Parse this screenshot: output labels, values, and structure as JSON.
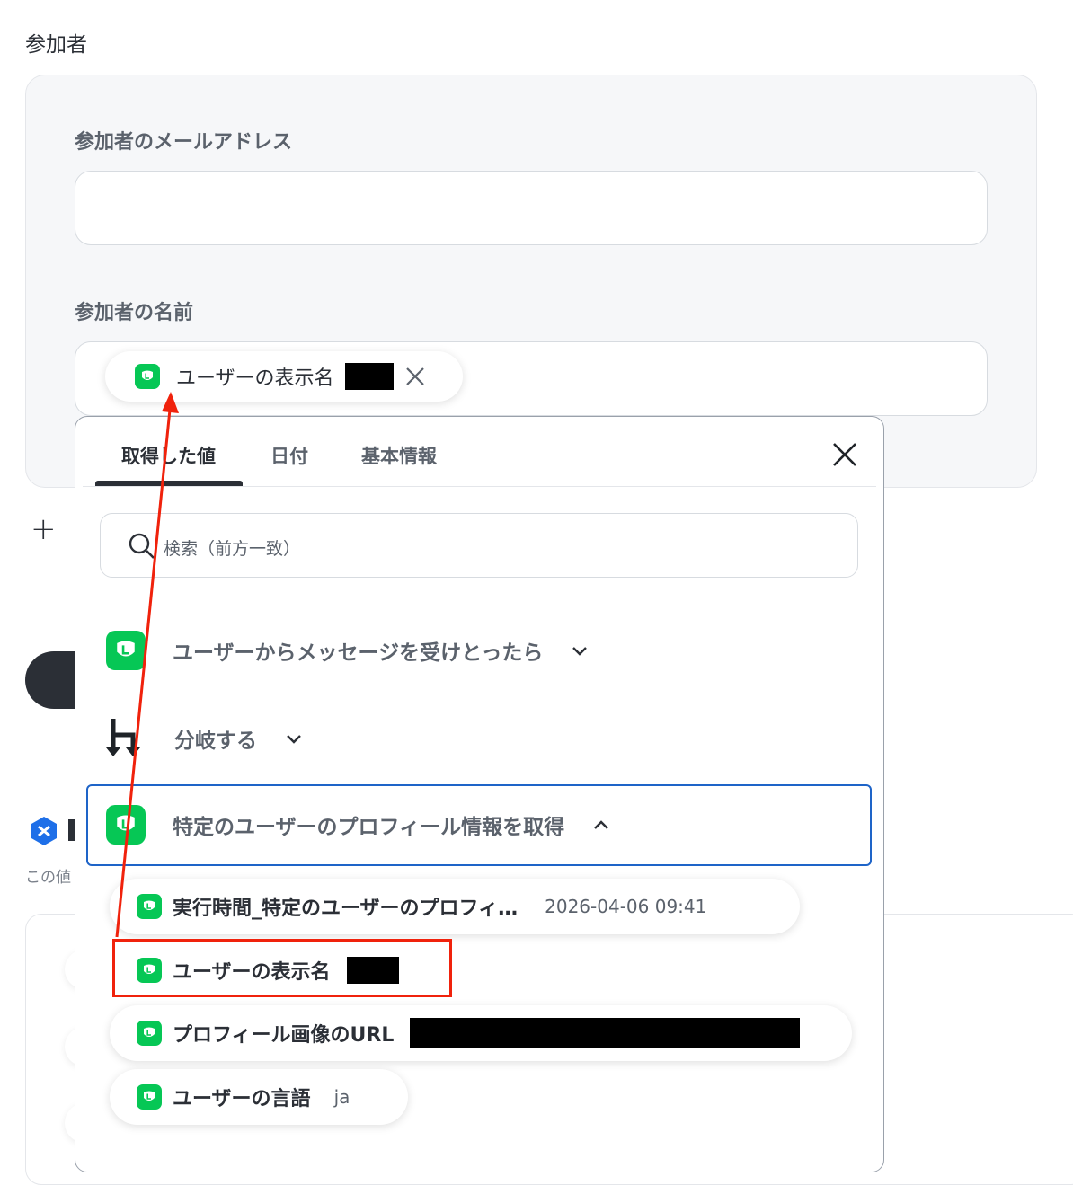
{
  "section_title": "参加者",
  "email_field": {
    "label": "参加者のメールアドレス",
    "value": ""
  },
  "name_field": {
    "label": "参加者の名前",
    "chip": {
      "label": "ユーザーの表示名"
    }
  },
  "picker": {
    "tabs": [
      "取得した値",
      "日付",
      "基本情報"
    ],
    "active_tab": "取得した値",
    "search_placeholder": "検索（前方一致）",
    "groups": [
      {
        "label": "ユーザーからメッセージを受けとったら",
        "icon": "line-icon",
        "expanded": false
      },
      {
        "label": "分岐する",
        "icon": "branch-icon",
        "expanded": false
      },
      {
        "label": "特定のユーザーのプロフィール情報を取得",
        "icon": "line-icon",
        "expanded": true,
        "selected": true
      }
    ],
    "items": [
      {
        "label": "実行時間_特定のユーザーのプロフィ…",
        "value": "2026-04-06 09:41"
      },
      {
        "label": "ユーザーの表示名",
        "value": ""
      },
      {
        "label": "プロフィール画像のURL",
        "value": ""
      },
      {
        "label": "ユーザーの言語",
        "value": "ja"
      }
    ]
  },
  "background": {
    "hint_text": "この値"
  },
  "colors": {
    "accent": "#06c755",
    "selected_border": "#1e64c8",
    "annotation": "#f0220c",
    "dark": "#2b2f36"
  }
}
